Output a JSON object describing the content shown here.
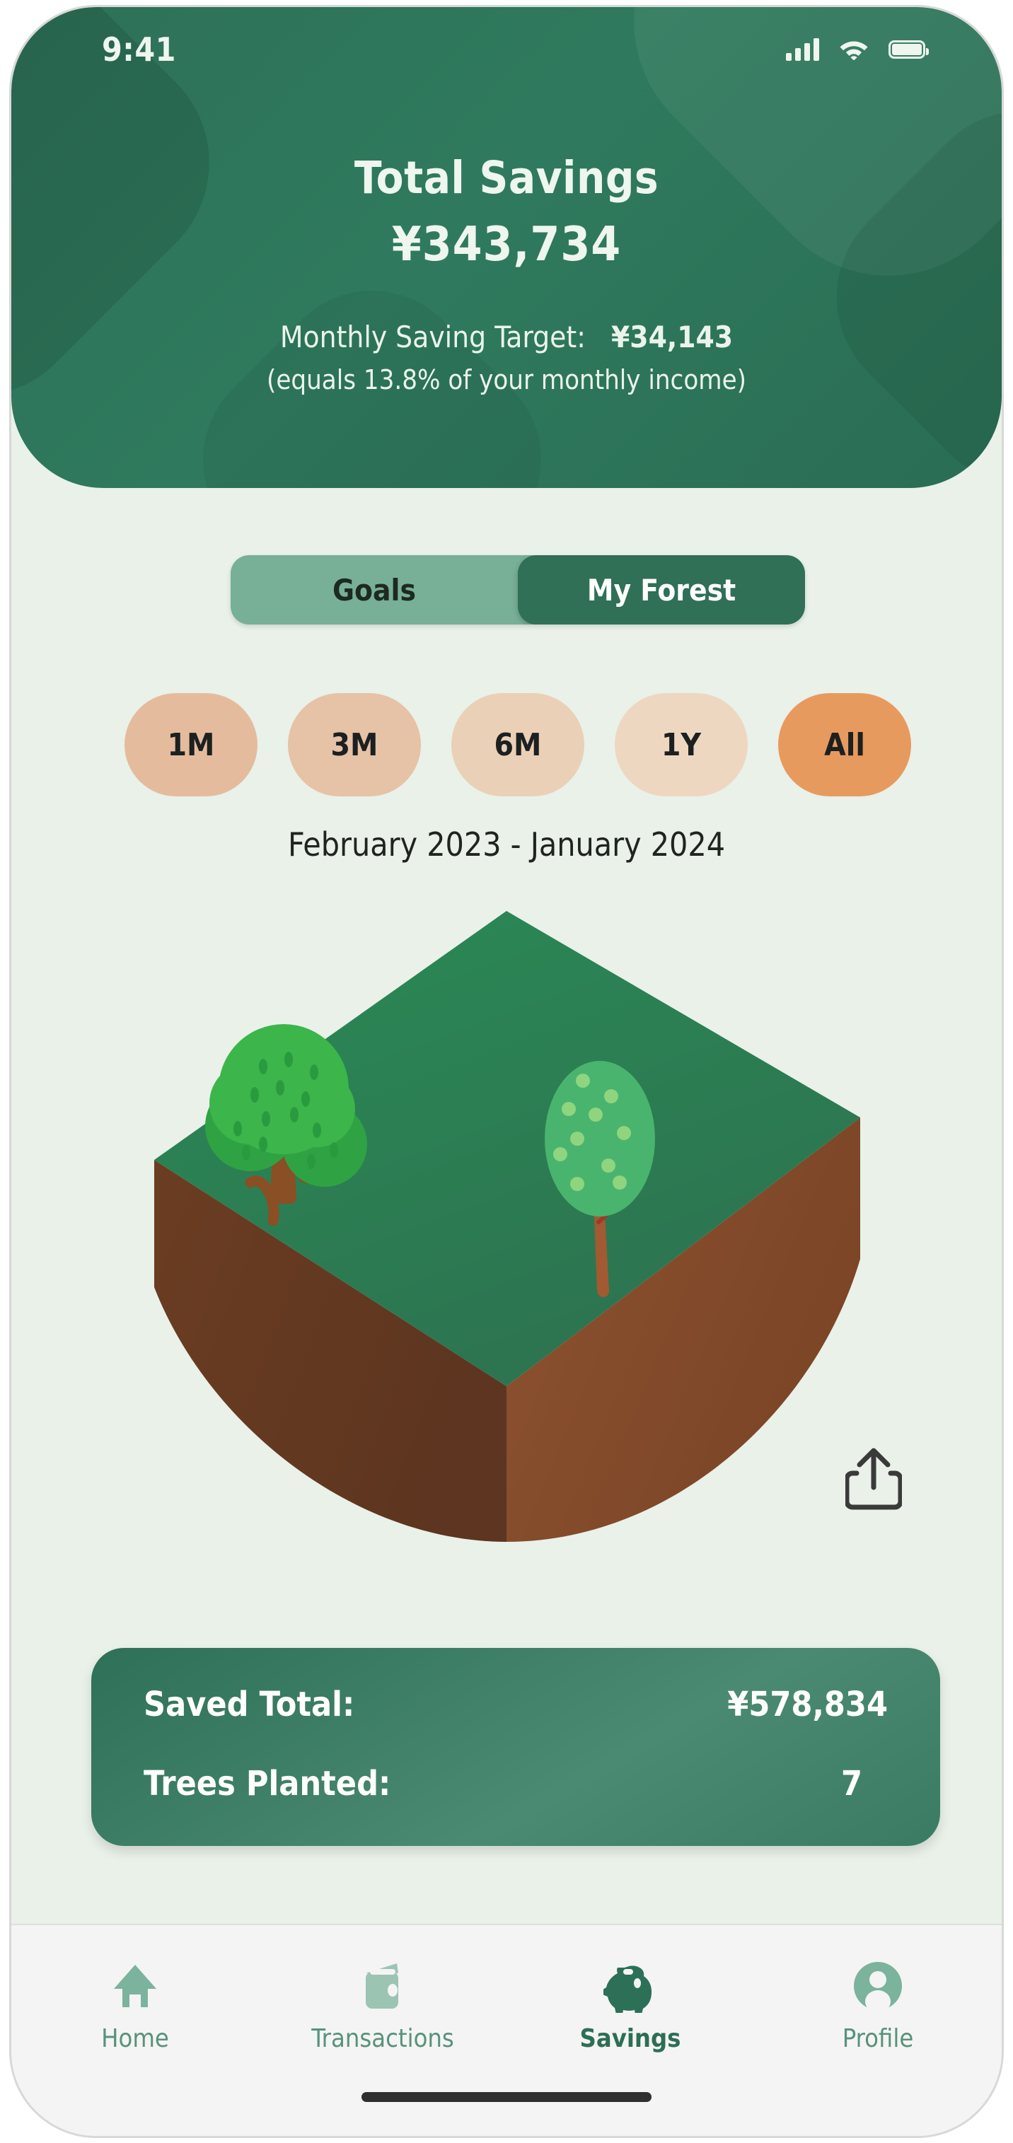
{
  "status_bar": {
    "time": "9:41",
    "signal_icon": "cellular-signal-icon",
    "wifi_icon": "wifi-icon",
    "battery_icon": "battery-full-icon"
  },
  "header": {
    "title": "Total Savings",
    "total_amount": "¥343,734",
    "target_label": "Monthly Saving Target:",
    "target_value": "¥34,143",
    "income_note": "(equals 13.8% of your monthly income)",
    "background_color": "#2f7a5e",
    "text_color": "#eef6ee"
  },
  "segmented_control": {
    "options": [
      {
        "label": "Goals",
        "selected": false
      },
      {
        "label": "My Forest",
        "selected": true
      }
    ],
    "track_color": "#77b096",
    "selected_color": "#2f7057"
  },
  "range_filter": {
    "options": [
      {
        "label": "1M",
        "selected": false
      },
      {
        "label": "3M",
        "selected": false
      },
      {
        "label": "6M",
        "selected": false
      },
      {
        "label": "1Y",
        "selected": false
      },
      {
        "label": "All",
        "selected": true
      }
    ],
    "selected_color": "#e79a5e",
    "unselected_color": "#e7c4a6"
  },
  "date_range": "February 2023 - January 2024",
  "illustration": {
    "name": "isometric-forest-plot",
    "grass_color": "#2e8055",
    "soil_color": "#7a4526",
    "tree_count": 2,
    "trees": [
      {
        "name": "broadleaf-tree",
        "canopy_color": "#3cb54a",
        "trunk_color": "#8a4f24"
      },
      {
        "name": "oval-tree",
        "canopy_color": "#49b46d",
        "trunk_color": "#9c5430"
      }
    ]
  },
  "share_button": {
    "icon": "share-icon",
    "color": "#3a3a3a"
  },
  "stats_card": {
    "rows": [
      {
        "label": "Saved Total:",
        "value": "¥578,834"
      },
      {
        "label": "Trees Planted:",
        "value": "7"
      }
    ],
    "background_color": "#3b7b63"
  },
  "tab_bar": {
    "items": [
      {
        "label": "Home",
        "icon": "home-icon",
        "active": false
      },
      {
        "label": "Transactions",
        "icon": "wallet-icon",
        "active": false
      },
      {
        "label": "Savings",
        "icon": "piggy-bank-icon",
        "active": true
      },
      {
        "label": "Profile",
        "icon": "person-icon",
        "active": false
      }
    ],
    "active_color": "#2d6e56",
    "inactive_color": "#58927c"
  }
}
